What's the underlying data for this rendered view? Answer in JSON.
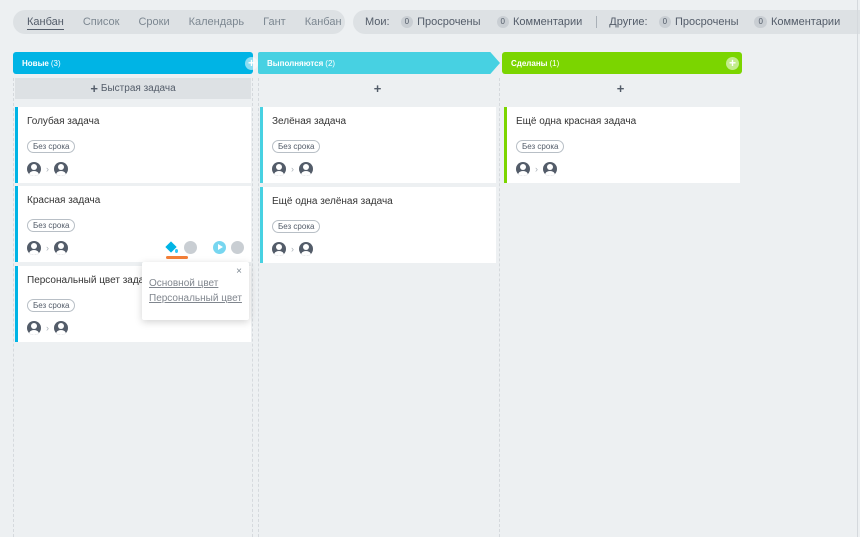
{
  "tabs": [
    "Канбан",
    "Список",
    "Сроки",
    "Календарь",
    "Гант",
    "Канбан"
  ],
  "filters": {
    "mine_label": "Мои:",
    "others_label": "Другие:",
    "mine": [
      {
        "count": "0",
        "label": "Просрочены"
      },
      {
        "count": "0",
        "label": "Комментарии"
      }
    ],
    "others": [
      {
        "count": "0",
        "label": "Просрочены"
      },
      {
        "count": "0",
        "label": "Комментарии"
      }
    ]
  },
  "columns": {
    "new": {
      "title": "Новые",
      "count": "(3)",
      "quick_task": "Быстрая задача",
      "color": "#00b4e5"
    },
    "progress": {
      "title": "Выполняются",
      "count": "(2)",
      "add": "+",
      "color": "#47d1e2"
    },
    "done": {
      "title": "Сделаны",
      "count": "(1)",
      "add": "+",
      "color": "#7bd500"
    }
  },
  "cards": {
    "new": [
      {
        "title": "Голубая задача",
        "badge": "Без срока"
      },
      {
        "title": "Красная задача",
        "badge": "Без срока"
      },
      {
        "title": "Персональный цвет задачи",
        "badge": "Без срока"
      }
    ],
    "progress": [
      {
        "title": "Зелёная задача",
        "badge": "Без срока"
      },
      {
        "title": "Ещё одна зелёная задача",
        "badge": "Без срока"
      }
    ],
    "done": [
      {
        "title": "Ещё одна красная задача",
        "badge": "Без срока"
      }
    ]
  },
  "color_popup": {
    "close": "×",
    "options": [
      "Основной цвет",
      "Персональный цвет"
    ]
  },
  "icons": {
    "add": "plus-icon",
    "arrow": "chevron-right-icon",
    "paint": "paint-bucket-icon",
    "play": "play-icon",
    "stop": "stop-icon"
  }
}
